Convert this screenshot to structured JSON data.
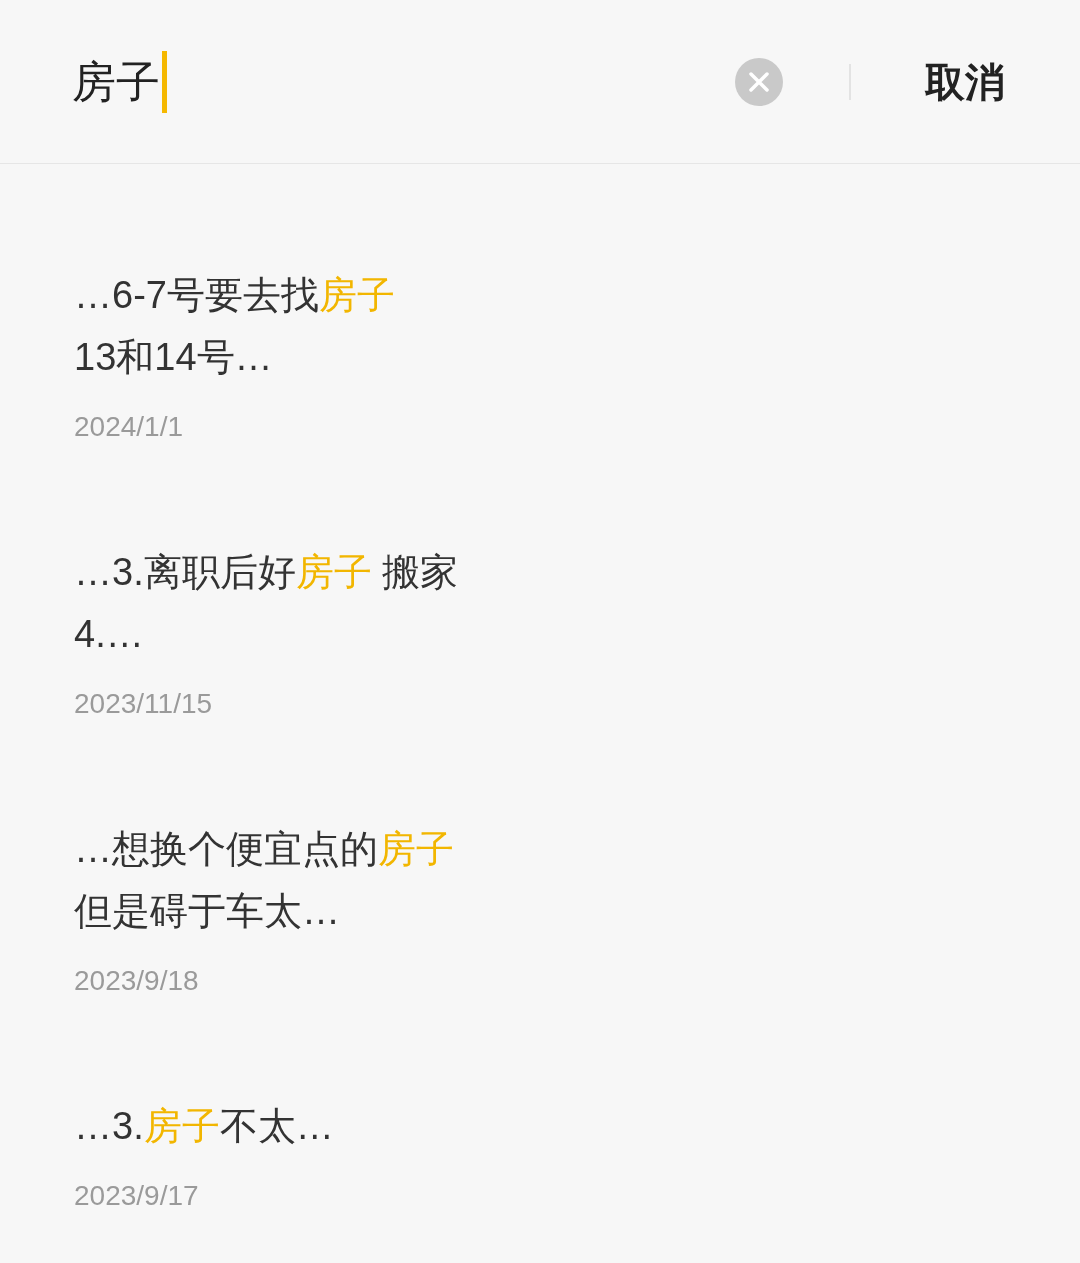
{
  "search": {
    "value": "房子",
    "cancel": "取消"
  },
  "results": [
    {
      "snippet": [
        [
          {
            "text": "…6-7号要去找",
            "highlight": false
          },
          {
            "text": "房子",
            "highlight": true
          }
        ],
        [
          {
            "text": "13和14号…",
            "highlight": false
          }
        ]
      ],
      "date": "2024/1/1"
    },
    {
      "snippet": [
        [
          {
            "text": "…3.离职后好",
            "highlight": false
          },
          {
            "text": "房子",
            "highlight": true
          },
          {
            "text": " 搬家",
            "highlight": false
          }
        ],
        [
          {
            "text": "4.…",
            "highlight": false
          }
        ]
      ],
      "date": "2023/11/15"
    },
    {
      "snippet": [
        [
          {
            "text": "…想换个便宜点的",
            "highlight": false
          },
          {
            "text": "房子",
            "highlight": true
          }
        ],
        [
          {
            "text": "但是碍于车太…",
            "highlight": false
          }
        ]
      ],
      "date": "2023/9/18"
    },
    {
      "snippet": [
        [
          {
            "text": "…3.",
            "highlight": false
          },
          {
            "text": "房子",
            "highlight": true
          },
          {
            "text": "不太…",
            "highlight": false
          }
        ]
      ],
      "date": "2023/9/17"
    }
  ]
}
